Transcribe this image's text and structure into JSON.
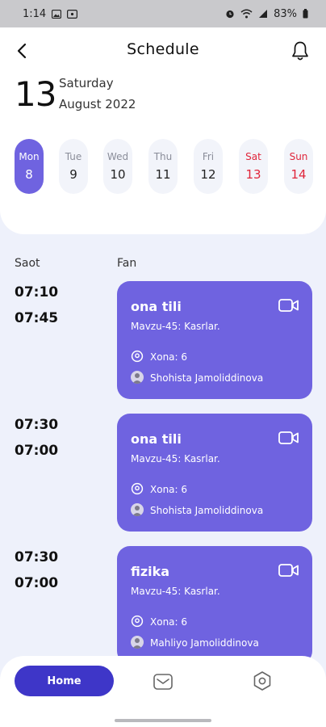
{
  "status_bar": {
    "time": "1:14",
    "battery": "83%",
    "icons": [
      "image-icon",
      "cast-icon",
      "alarm-icon",
      "wifi-icon",
      "signal-icon",
      "battery-icon"
    ]
  },
  "header": {
    "title": "Schedule",
    "back_icon": "back-arrow-icon",
    "bell_icon": "bell-icon"
  },
  "date": {
    "day_number": "13",
    "weekday": "Saturday",
    "month_year": "August 2022"
  },
  "week": [
    {
      "name": "Mon",
      "num": "8",
      "state": "active"
    },
    {
      "name": "Tue",
      "num": "9",
      "state": "normal"
    },
    {
      "name": "Wed",
      "num": "10",
      "state": "normal"
    },
    {
      "name": "Thu",
      "num": "11",
      "state": "normal"
    },
    {
      "name": "Fri",
      "num": "12",
      "state": "normal"
    },
    {
      "name": "Sat",
      "num": "13",
      "state": "weekend"
    },
    {
      "name": "Sun",
      "num": "14",
      "state": "weekend"
    }
  ],
  "columns": {
    "time": "Saot",
    "subject": "Fan"
  },
  "lessons": [
    {
      "start": "07:10",
      "end": "07:45",
      "subject": "ona tili",
      "topic": "Mavzu-45: Kasrlar.",
      "room": "Xona: 6",
      "teacher": "Shohista Jamoliddinova"
    },
    {
      "start": "07:30",
      "end": "07:00",
      "subject": "ona tili",
      "topic": "Mavzu-45: Kasrlar.",
      "room": "Xona: 6",
      "teacher": "Shohista Jamoliddinova"
    },
    {
      "start": "07:30",
      "end": "07:00",
      "subject": "fizika",
      "topic": "Mavzu-45: Kasrlar.",
      "room": "Xona: 6",
      "teacher": "Mahliyo Jamoliddinova"
    }
  ],
  "nav": {
    "home_label": "Home",
    "mail_icon": "mail-icon",
    "settings_icon": "settings-icon"
  },
  "colors": {
    "accent": "#6f63e0",
    "home_button": "#3e36c8",
    "weekend": "#e0263b",
    "background": "#eef1fb"
  }
}
